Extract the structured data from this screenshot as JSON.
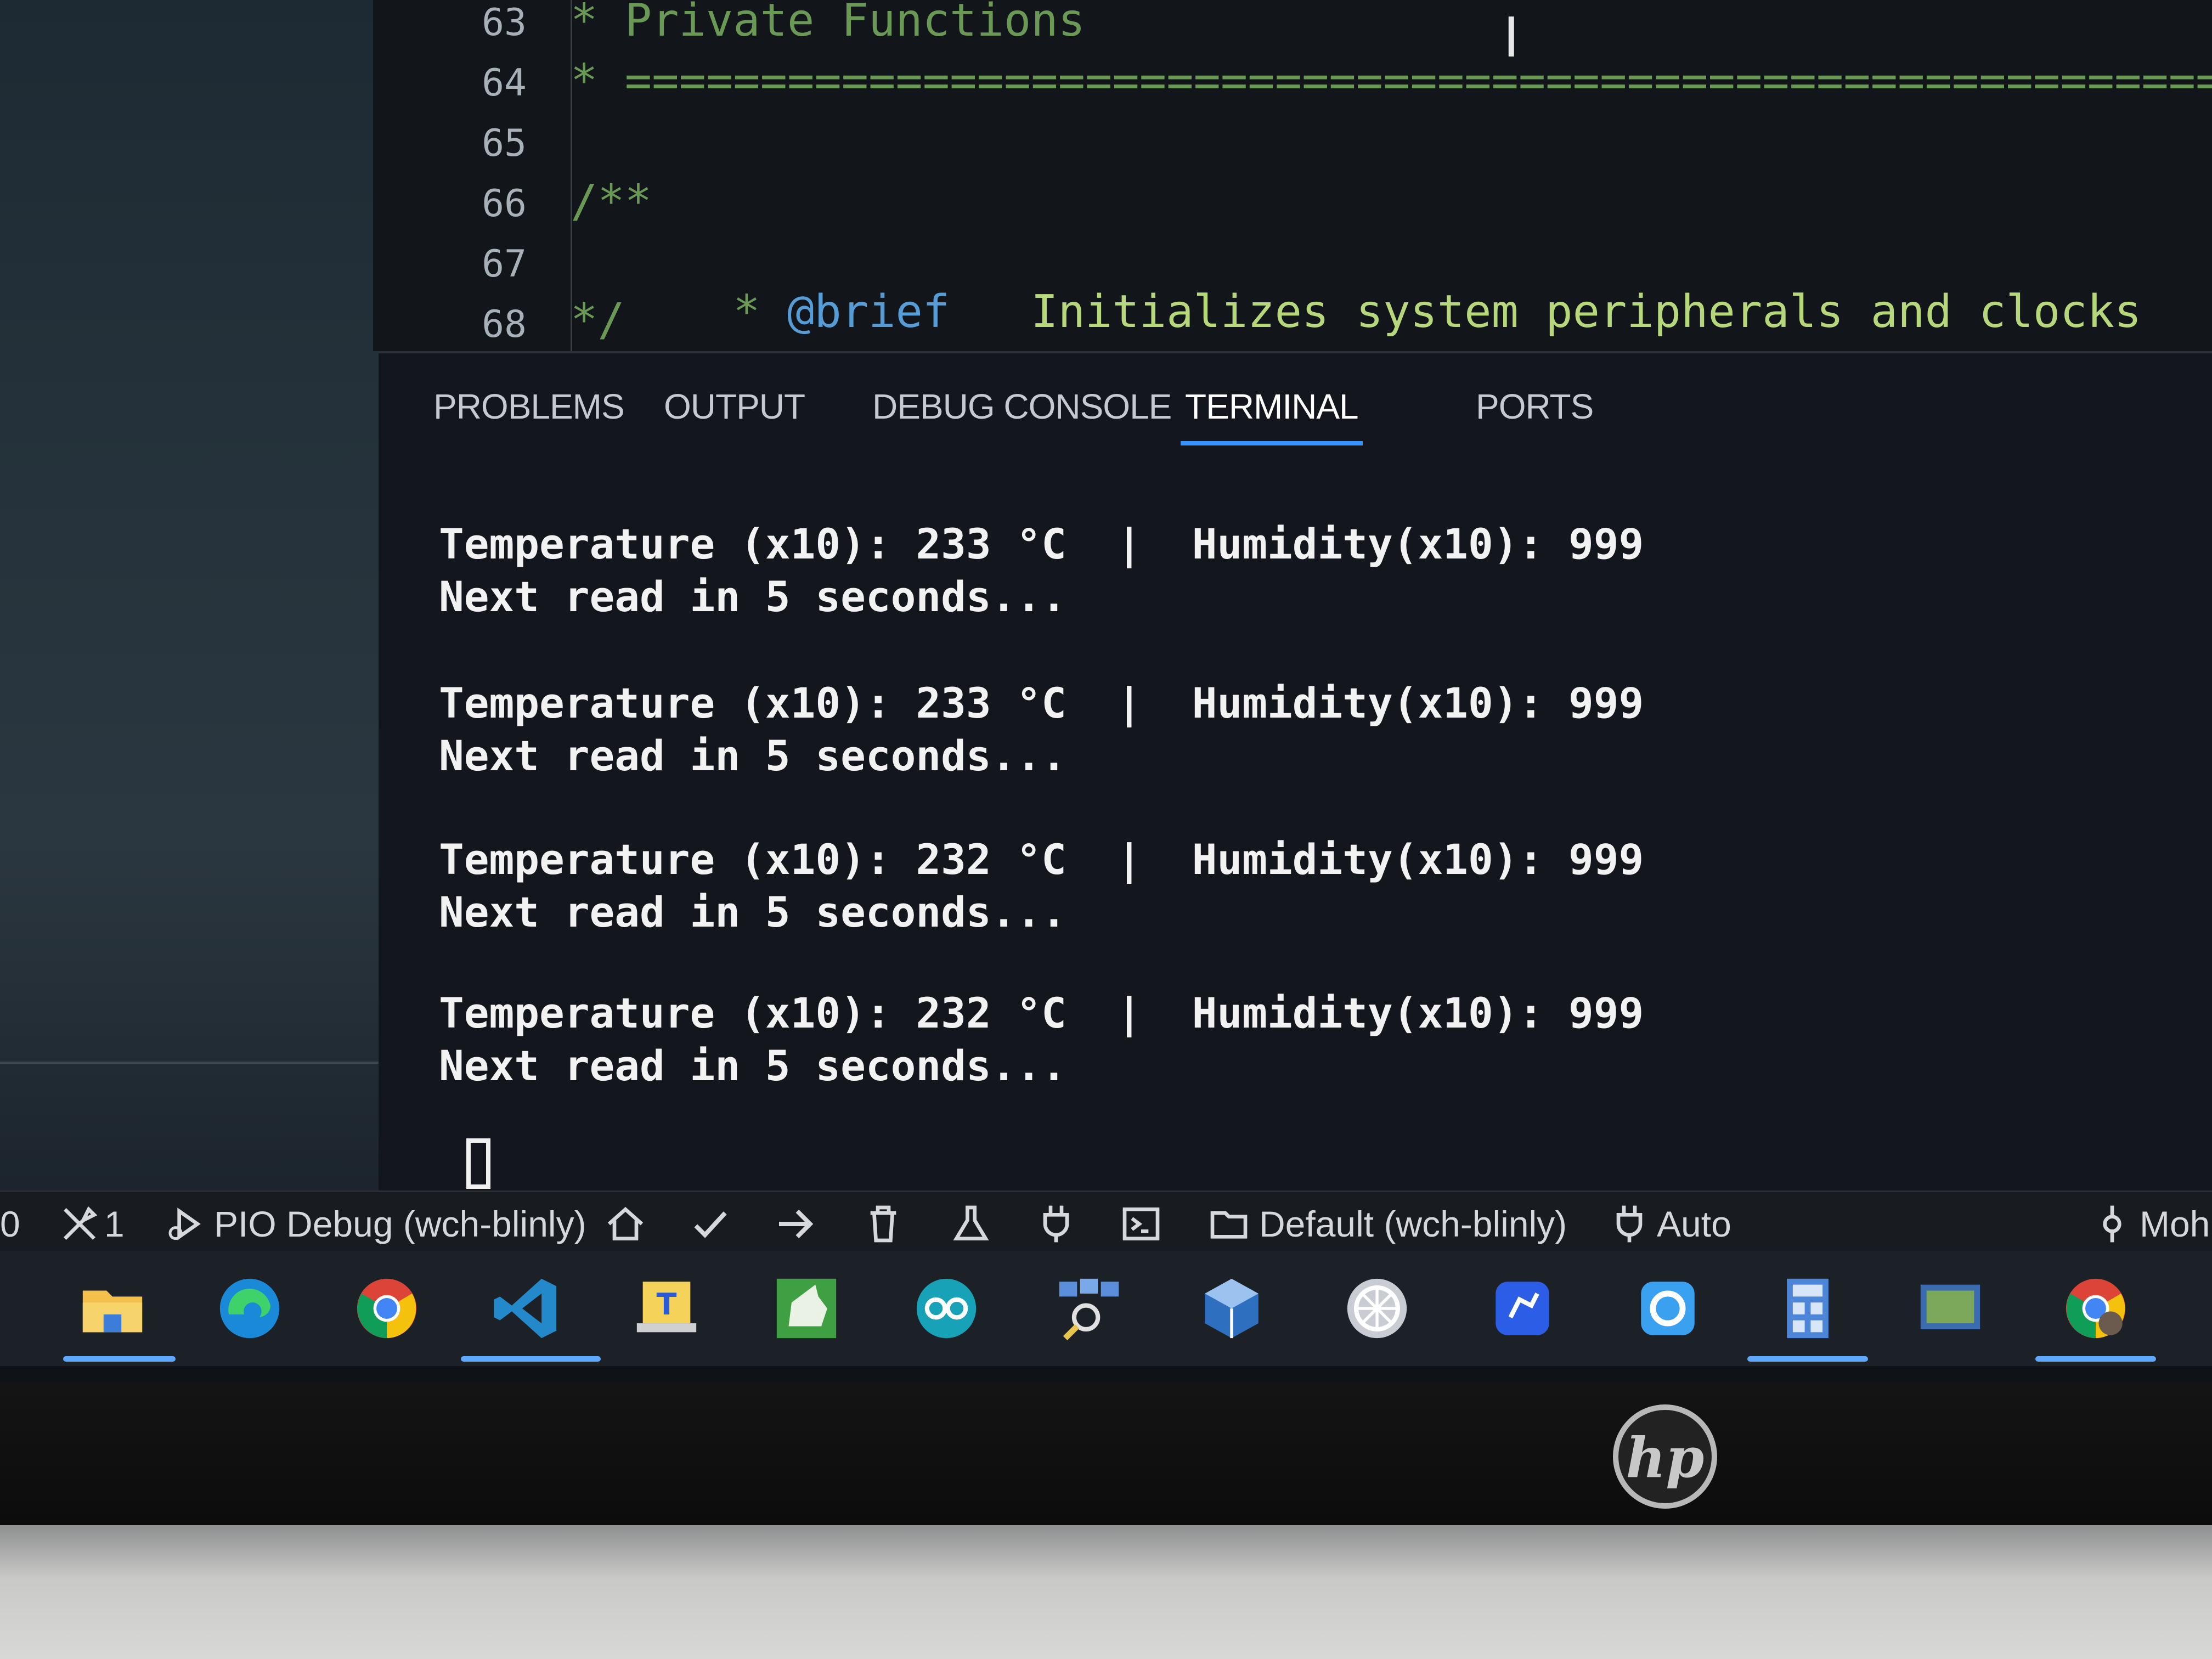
{
  "editor": {
    "lines": [
      {
        "number": "63",
        "text": "* Private Functions"
      },
      {
        "number": "64",
        "text": "* ======================================================================"
      },
      {
        "number": "65",
        "text": ""
      },
      {
        "number": "66",
        "text": "/**"
      },
      {
        "number": "67",
        "star": "* ",
        "tag": "@brief",
        "desc": "   Initializes system peripherals and clocks"
      },
      {
        "number": "68",
        "text": "*/"
      }
    ]
  },
  "panel": {
    "tabs": [
      "PROBLEMS",
      "OUTPUT",
      "DEBUG CONSOLE",
      "TERMINAL",
      "PORTS"
    ],
    "active_tab": "TERMINAL"
  },
  "terminal": {
    "entries": [
      {
        "temp": "Temperature (x10): 233 °C",
        "sep": "|",
        "hum": "Humidity(x10): 999",
        "next": "Next read in 5 seconds..."
      },
      {
        "temp": "Temperature (x10): 233 °C",
        "sep": "|",
        "hum": "Humidity(x10): 999",
        "next": "Next read in 5 seconds..."
      },
      {
        "temp": "Temperature (x10): 232 °C",
        "sep": "|",
        "hum": "Humidity(x10): 999",
        "next": "Next read in 5 seconds..."
      },
      {
        "temp": "Temperature (x10): 232 °C",
        "sep": "|",
        "hum": "Humidity(x10): 999",
        "next": "Next read in 5 seconds..."
      }
    ]
  },
  "statusbar": {
    "errors": "0",
    "tools_count": "1",
    "debug_label": "PIO Debug (wch-blinly)",
    "env_label": "Default (wch-blinly)",
    "auto_label": "Auto",
    "user_label": "Moh"
  },
  "taskbar": {
    "icons": [
      "file-explorer",
      "edge",
      "chrome",
      "vscode",
      "typora",
      "app-green",
      "arduino",
      "network-tool",
      "virtualbox",
      "app-wheel",
      "app-blue",
      "sync-app",
      "calculator",
      "board-app",
      "chrome-profile"
    ]
  },
  "colors": {
    "accent": "#3794ff",
    "comment": "#6a9955",
    "doc_tag": "#569cd6"
  }
}
